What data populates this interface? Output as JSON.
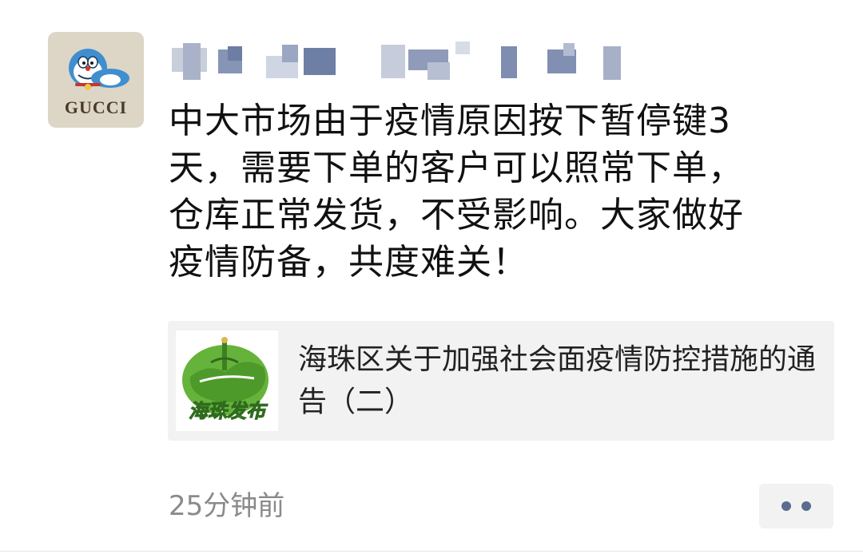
{
  "avatar": {
    "brand_text": "GUCCI",
    "icon": "cartoon-cat-avatar-icon",
    "background_color": "#ddd6c6"
  },
  "post": {
    "text": "中大市场由于疫情原因按下暂停键3\n天，需要下单的客户可以照常下单，\n仓库正常发货，不受影响。大家做好\n疫情防备，共度难关！"
  },
  "link_card": {
    "title": "海珠区关于加强社会面疫情防控措施的通告（二）",
    "thumbnail_text": "海珠发布",
    "thumbnail_icon": "haizhu-map-logo-icon",
    "background_color": "#f2f2f2"
  },
  "footer": {
    "timestamp": "25分钟前",
    "more_icon": "ellipsis-icon",
    "accent_color": "#5b6d8e"
  }
}
